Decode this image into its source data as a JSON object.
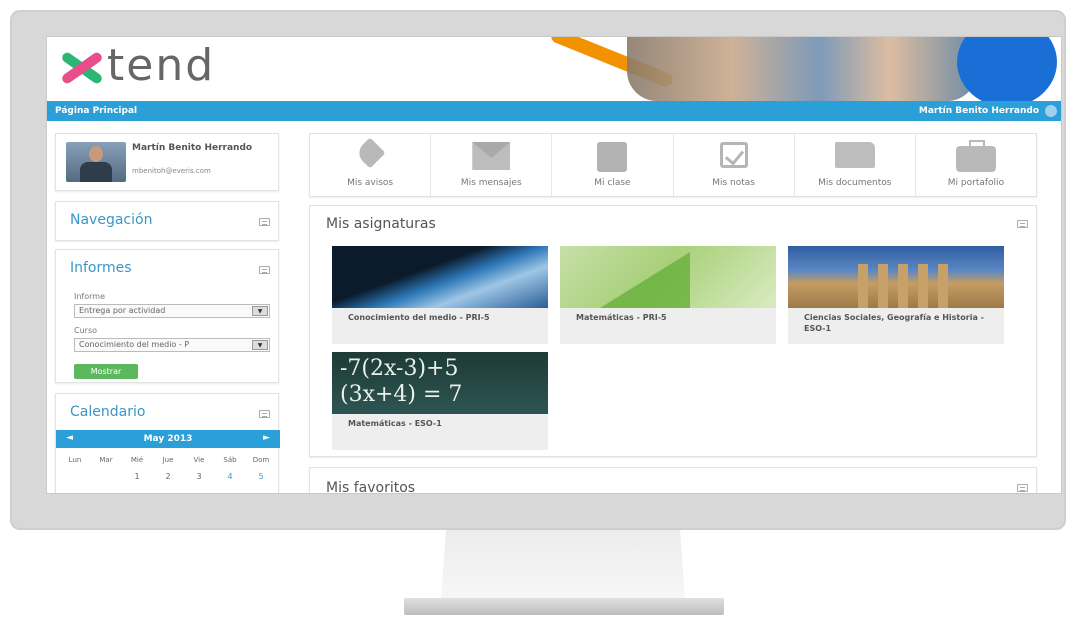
{
  "logo": {
    "text": "tend"
  },
  "topbar": {
    "home": "Página Principal",
    "user": "Martín Benito Herrando"
  },
  "profile": {
    "name": "Martín Benito Herrando",
    "email": "mbenitoh@everis.com"
  },
  "navigation": {
    "title": "Navegación"
  },
  "informes": {
    "title": "Informes",
    "report_label": "Informe",
    "report_value": "Entrega por actividad",
    "course_label": "Curso",
    "course_value": "Conocimiento del medio - P",
    "button": "Mostrar"
  },
  "calendar": {
    "title": "Calendario",
    "month": "May 2013",
    "prev": "◄",
    "next": "►",
    "days": [
      "Lun",
      "Mar",
      "Mié",
      "Jue",
      "Vie",
      "Sáb",
      "Dom"
    ],
    "first_week": [
      "",
      "",
      "1",
      "2",
      "3",
      "4",
      "5"
    ]
  },
  "shortcuts": [
    {
      "label": "Mis avisos",
      "icon": "pin-icon"
    },
    {
      "label": "Mis mensajes",
      "icon": "envelope-icon"
    },
    {
      "label": "Mi clase",
      "icon": "class-icon"
    },
    {
      "label": "Mis notas",
      "icon": "checkbox-icon"
    },
    {
      "label": "Mis documentos",
      "icon": "folder-icon"
    },
    {
      "label": "Mi portafolio",
      "icon": "briefcase-icon"
    }
  ],
  "asignaturas": {
    "title": "Mis asignaturas",
    "courses": [
      {
        "name": "Conocimiento del medio - PRI-5"
      },
      {
        "name": "Matemáticas - PRI-5"
      },
      {
        "name": "Ciencias Sociales, Geografía e Historia - ESO-1"
      },
      {
        "name": "Matemáticas - ESO-1",
        "board_text_1": "-7(2x-3)+5",
        "board_text_2": "(3x+4) = 7"
      }
    ]
  },
  "favoritos": {
    "title": "Mis favoritos"
  },
  "colors": {
    "accent": "#2a9fd8",
    "button": "#5cb85c",
    "logo_green": "#2bb673",
    "logo_pink": "#e84e8a"
  }
}
